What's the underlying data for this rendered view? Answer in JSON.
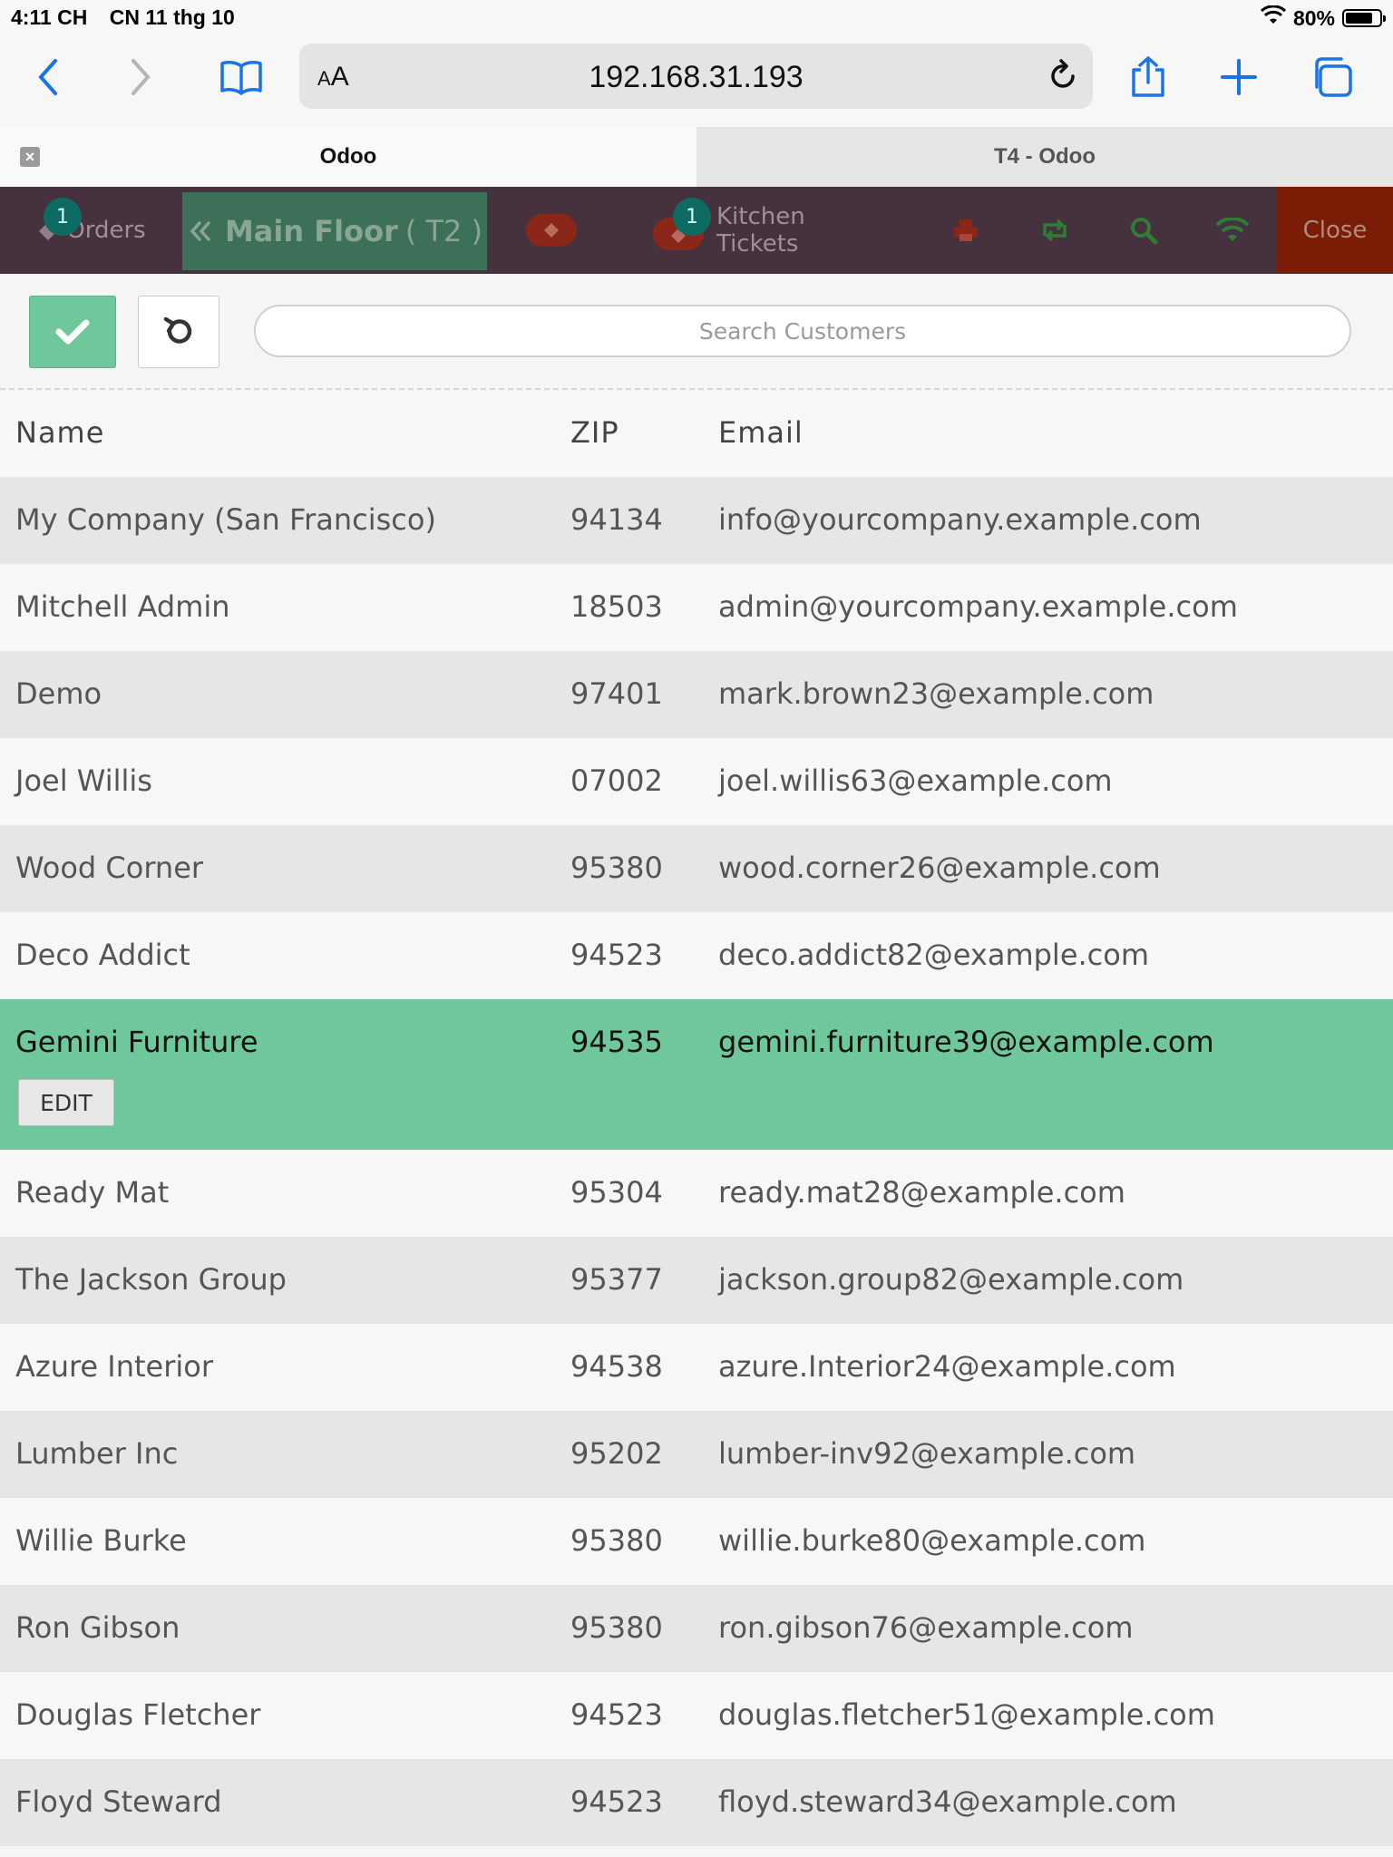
{
  "status": {
    "time": "4:11 CH",
    "date": "CN 11 thg 10",
    "battery": "80%",
    "battery_level": 0.8
  },
  "browser": {
    "aa_small": "A",
    "aa_big": "A",
    "url": "192.168.31.193"
  },
  "tabs": [
    {
      "label": "Odoo"
    },
    {
      "label": "T4 - Odoo"
    }
  ],
  "pos": {
    "orders_label": "Orders",
    "orders_count": "1",
    "floor_label": "Main Floor",
    "floor_table": "( T2 )",
    "kitchen_label": "Kitchen Tickets",
    "kitchen_count": "1",
    "close_label": "Close"
  },
  "search": {
    "placeholder": "Search Customers"
  },
  "table": {
    "headers": {
      "name": "Name",
      "zip": "ZIP",
      "email": "Email"
    },
    "edit_label": "EDIT",
    "rows": [
      {
        "name": "My Company (San Francisco)",
        "zip": "94134",
        "email": "info@yourcompany.example.com"
      },
      {
        "name": "Mitchell Admin",
        "zip": "18503",
        "email": "admin@yourcompany.example.com"
      },
      {
        "name": "Demo",
        "zip": "97401",
        "email": "mark.brown23@example.com"
      },
      {
        "name": "Joel Willis",
        "zip": "07002",
        "email": "joel.willis63@example.com"
      },
      {
        "name": "Wood Corner",
        "zip": "95380",
        "email": "wood.corner26@example.com"
      },
      {
        "name": "Deco Addict",
        "zip": "94523",
        "email": "deco.addict82@example.com"
      },
      {
        "name": "Gemini Furniture",
        "zip": "94535",
        "email": "gemini.furniture39@example.com"
      },
      {
        "name": "Ready Mat",
        "zip": "95304",
        "email": "ready.mat28@example.com"
      },
      {
        "name": "The Jackson Group",
        "zip": "95377",
        "email": "jackson.group82@example.com"
      },
      {
        "name": "Azure Interior",
        "zip": "94538",
        "email": "azure.Interior24@example.com"
      },
      {
        "name": "Lumber Inc",
        "zip": "95202",
        "email": "lumber-inv92@example.com"
      },
      {
        "name": "Willie Burke",
        "zip": "95380",
        "email": "willie.burke80@example.com"
      },
      {
        "name": "Ron Gibson",
        "zip": "95380",
        "email": "ron.gibson76@example.com"
      },
      {
        "name": "Douglas Fletcher",
        "zip": "94523",
        "email": "douglas.fletcher51@example.com"
      },
      {
        "name": "Floyd Steward",
        "zip": "94523",
        "email": "floyd.steward34@example.com"
      }
    ]
  }
}
